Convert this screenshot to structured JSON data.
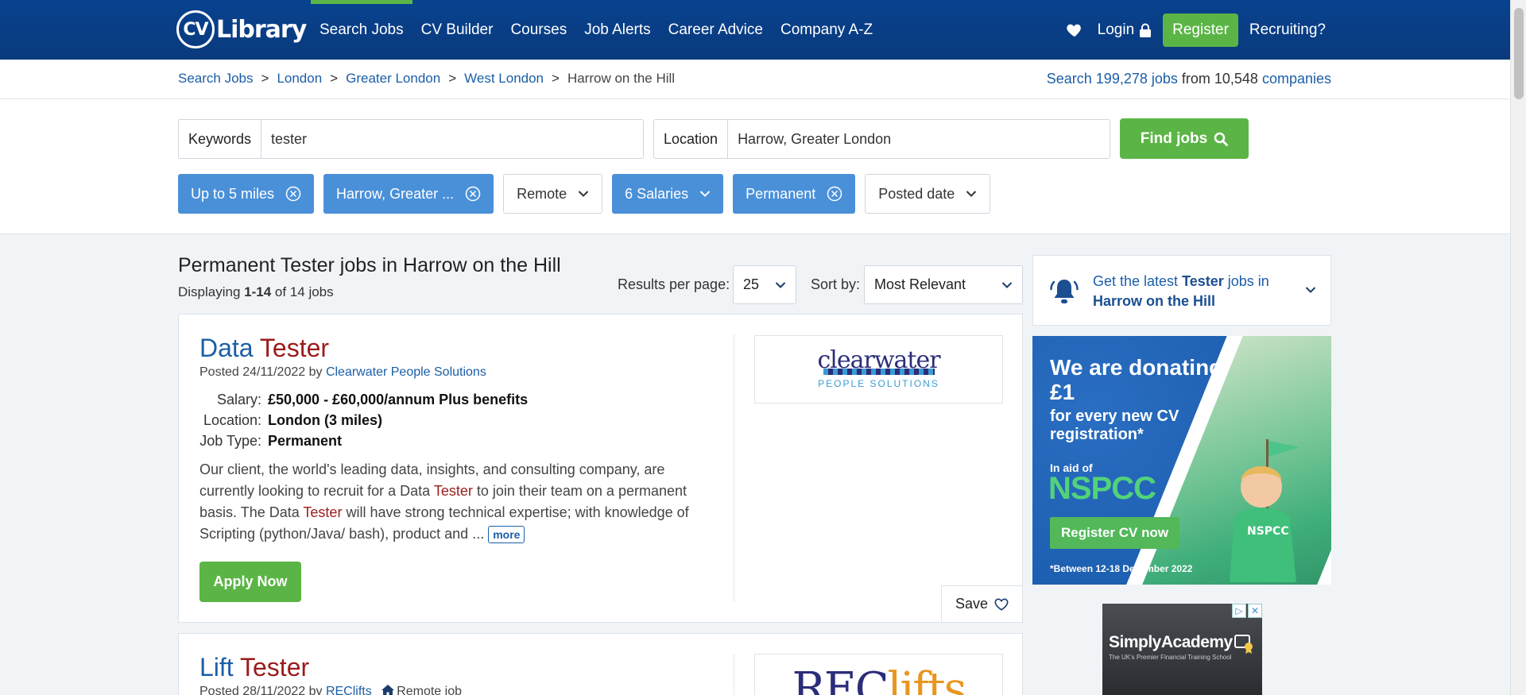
{
  "header": {
    "logo_cv": "CV",
    "logo_text": "Library",
    "nav": [
      "Search Jobs",
      "CV Builder",
      "Courses",
      "Job Alerts",
      "Career Advice",
      "Company A-Z"
    ],
    "login": "Login",
    "register": "Register",
    "recruiting": "Recruiting?"
  },
  "breadcrumb": {
    "items": [
      "Search Jobs",
      "London",
      "Greater London",
      "West London"
    ],
    "current": "Harrow on the Hill",
    "stats_prefix": "Search ",
    "stats_jobs": "199,278 jobs",
    "stats_mid": " from 10,548 ",
    "stats_companies": "companies"
  },
  "search": {
    "keywords_label": "Keywords",
    "keywords_value": "tester",
    "location_label": "Location",
    "location_value": "Harrow, Greater London",
    "find_label": "Find jobs"
  },
  "filters": [
    {
      "label": "Up to 5 miles",
      "active": true
    },
    {
      "label": "Harrow, Greater ...",
      "active": true
    },
    {
      "label": "Remote",
      "active": false
    },
    {
      "label": "6 Salaries",
      "active": true
    },
    {
      "label": "Permanent",
      "active": true
    },
    {
      "label": "Posted date",
      "active": false
    }
  ],
  "results": {
    "title": "Permanent Tester jobs in Harrow on the Hill",
    "count_prefix": "Displaying ",
    "count_range": "1-14",
    "count_suffix": " of 14 jobs",
    "per_page_label": "Results per page:",
    "per_page_value": "25",
    "sort_label": "Sort by:",
    "sort_value": "Most Relevant"
  },
  "jobs": [
    {
      "title_a": "Data ",
      "title_b": "Tester",
      "posted_prefix": "Posted 24/11/2022 by ",
      "company": "Clearwater People Solutions",
      "salary_key": "Salary:",
      "salary": "£50,000 - £60,000/annum Plus benefits",
      "location_key": "Location:",
      "location": "London (3 miles)",
      "type_key": "Job Type:",
      "type": "Permanent",
      "desc_1": "Our client, the world's leading data, insights, and consulting company, are currently looking to recruit for a Data ",
      "desc_hl1": "Tester",
      "desc_2": " to join their team on a permanent basis. The Data ",
      "desc_hl2": "Tester",
      "desc_3": " will have strong technical expertise; with knowledge of Scripting (python/Java/ bash), product and ... ",
      "more": "more",
      "apply": "Apply Now",
      "save": "Save",
      "logo_top": "clearwater",
      "logo_bottom": "PEOPLE SOLUTIONS"
    },
    {
      "title_a": "Lift ",
      "title_b": "Tester",
      "posted_prefix": "Posted 28/11/2022 by ",
      "company": "REClifts",
      "remote": "Remote job",
      "logo_a": "REC",
      "logo_b": "lifts"
    }
  ],
  "sidebar": {
    "alert_1": "Get the latest ",
    "alert_kw": "Tester",
    "alert_2": " jobs in ",
    "alert_loc": "Harrow on the Hill",
    "ad_h1": "We are donating £1",
    "ad_h2": "for every new CV registration*",
    "ad_aid": "In aid of",
    "ad_nspcc": "NSPCC",
    "ad_btn": "Register CV now",
    "ad_foot": "*Between 12-18 December 2022",
    "ad2_title": "SimplyAcademy",
    "ad2_sub": "The UK's Premier Financial Training School"
  },
  "colors": {
    "brand_blue": "#08428f",
    "accent_green": "#5bb546",
    "chip_blue": "#4a90d9",
    "keyword_red": "#9b1b1b"
  }
}
